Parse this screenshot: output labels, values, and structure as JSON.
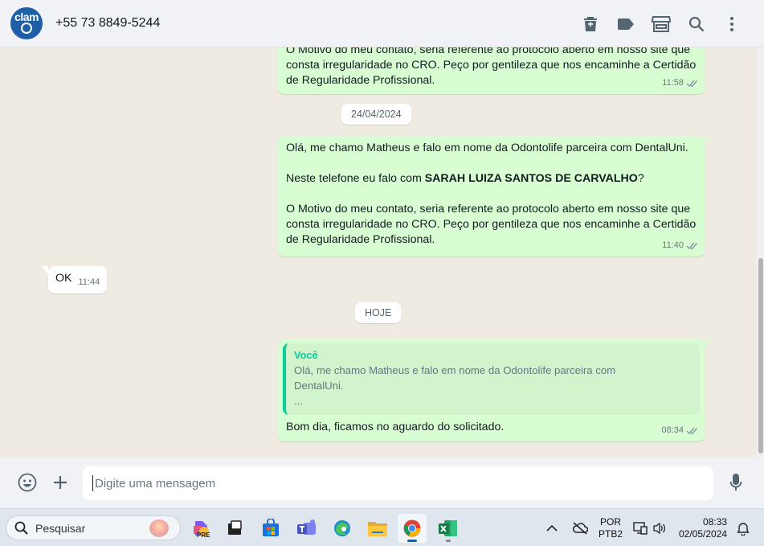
{
  "header": {
    "avatar_text": "clam",
    "contact_name": "+55 73 8849-5244",
    "icons": [
      "trash-icon",
      "label-icon",
      "shop-icon",
      "search-icon",
      "menu-icon"
    ]
  },
  "messages": {
    "msg1": {
      "lines": [
        "O Motivo do meu contato, seria referente ao protocolo aberto em nosso site que",
        "consta irregularidade no CRO. Peço por gentileza que nos encaminhe a Certidão",
        "de Regularidade Profissional."
      ],
      "time": "11:58"
    },
    "date1": "24/04/2024",
    "msg2": {
      "line1": "Olá, me chamo Matheus e falo em nome da Odontolife parceira com DentalUni.",
      "line2_prefix": "Neste telefone eu falo com ",
      "line2_bold": "SARAH LUIZA SANTOS DE CARVALHO",
      "line2_suffix": "?",
      "lines3": [
        "O Motivo do meu contato, seria referente ao protocolo aberto em nosso site que",
        "consta irregularidade no CRO. Peço por gentileza que nos encaminhe a Certidão",
        "de Regularidade Profissional."
      ],
      "time": "11:40"
    },
    "msg3": {
      "text": "OK",
      "time": "11:44"
    },
    "date2": "HOJE",
    "msg4": {
      "quote_author": "Você",
      "quote_line1": "Olá, me chamo Matheus e falo em nome da Odontolife parceira com",
      "quote_line2": "DentalUni.",
      "quote_line3": "...",
      "text": "Bom dia, ficamos no aguardo do solicitado.",
      "time": "08:34"
    }
  },
  "composer": {
    "placeholder": "Digite uma mensagem"
  },
  "taskbar": {
    "search_placeholder": "Pesquisar",
    "lang_line1": "POR",
    "lang_line2": "PTB2",
    "time": "08:33",
    "date": "02/05/2024",
    "pre_badge": "PRE"
  },
  "colors": {
    "outgoing_bubble": "#d9fdd3",
    "incoming_bubble": "#ffffff",
    "chat_background": "#efeae2",
    "quote_accent": "#06cf9c",
    "read_checks": "#8696a0"
  }
}
